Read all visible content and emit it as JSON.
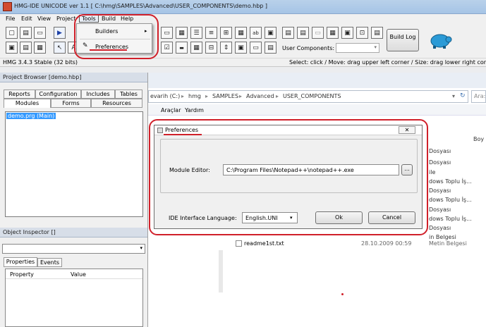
{
  "window_title": "HMG-IDE  UNICODE  ver 1.1  [ C:\\hmg\\SAMPLES\\Advanced\\USER_COMPONENTS\\demo.hbp ]",
  "menu": [
    "File",
    "Edit",
    "View",
    "Project",
    "Tools",
    "Build",
    "Help"
  ],
  "tools_menu": {
    "builders": "Builders",
    "preferences": "Preferences"
  },
  "toolbar": {
    "build_log": "Build Log",
    "user_components_label": "User Components:"
  },
  "status": {
    "version": "HMG 3.4.3 Stable (32 bits)",
    "hint": "Select: click / Move: drag upper left corner / Size: drag lower right corner"
  },
  "project_browser": {
    "title": "Project Browser [demo.hbp]",
    "tabs_top": [
      "Reports",
      "Configuration",
      "Includes",
      "Tables"
    ],
    "tabs_bottom": [
      "Modules",
      "Forms",
      "Resources"
    ],
    "items": [
      "demo.prg (Main)"
    ]
  },
  "object_inspector": {
    "title": "Object Inspector []",
    "tabs": [
      "Properties",
      "Events"
    ],
    "columns": [
      "Property",
      "Value"
    ]
  },
  "explorer": {
    "breadcrumb": [
      "evarih (C:)",
      "hmg",
      "SAMPLES",
      "Advanced",
      "USER_COMPONENTS"
    ],
    "search_placeholder": "Ara: ",
    "menu": [
      "Araçlar",
      "Yardım"
    ],
    "header_right": "Boy",
    "types": [
      "Dosyası",
      "Dosyası",
      "ile",
      "dows Toplu İş...",
      "Dosyası",
      "dows Toplu İş...",
      "Dosyası",
      "dows Toplu İş...",
      "Dosyası",
      "in Belgesi"
    ],
    "last_file": {
      "name": "readme1st.txt",
      "date": "28.10.2009 00:59",
      "type": "Metin Belgesi"
    }
  },
  "preferences_dialog": {
    "title": "Preferences",
    "module_editor_label": "Module Editor:",
    "module_editor_value": "C:\\Program Files\\Notepad++\\notepad++.exe",
    "browse": "...",
    "language_label": "IDE Interface Language:",
    "language_value": "English.UNI",
    "ok": "Ok",
    "cancel": "Cancel"
  },
  "colors": {
    "highlight": "#d0202a",
    "selection": "#3399ff"
  }
}
